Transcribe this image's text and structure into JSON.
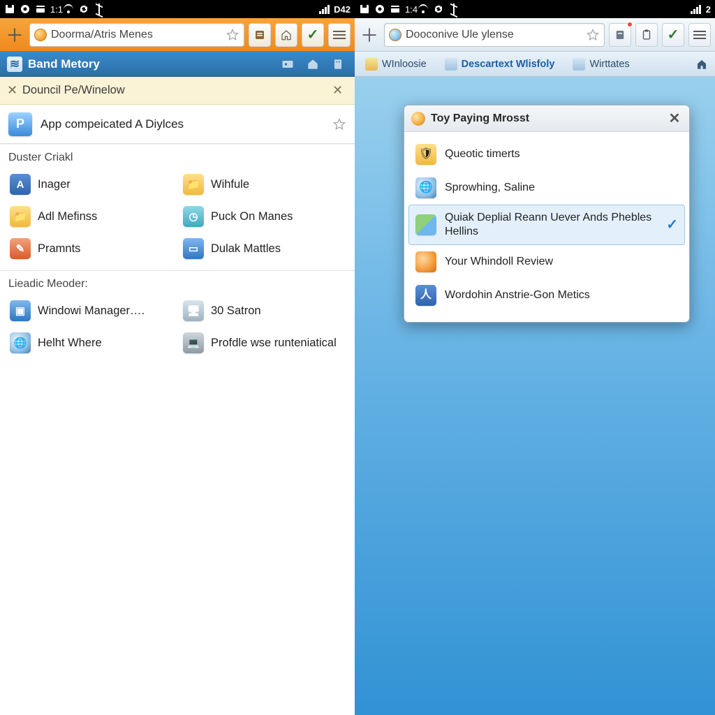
{
  "status": {
    "left": {
      "time": "1:1",
      "label": "D42"
    },
    "right": {
      "time": "1:4",
      "label": "2"
    }
  },
  "left": {
    "url": "Doorma/Atris Menes",
    "subheader": "Band Metory",
    "info_row": "Douncil Pe/Winelow",
    "featured": "App compeicated A Diylces",
    "sec1_label": "Duster Criakl",
    "sec1_items": [
      {
        "label": "Inager"
      },
      {
        "label": "Wihfule"
      },
      {
        "label": "Adl Mefinss"
      },
      {
        "label": "Puck On Manes"
      },
      {
        "label": "Pramnts"
      },
      {
        "label": "Dulak Mattles"
      }
    ],
    "sec2_label": "Lieadic Meoder:",
    "sec2_items": [
      {
        "label": "Windowi Manager…."
      },
      {
        "label": "30 Satron"
      },
      {
        "label": "Helht Where"
      },
      {
        "label": "Profdle wse runteniatical"
      }
    ]
  },
  "right": {
    "url": "Dooconive Ule ylense",
    "tabs": [
      {
        "label": "WInloosie"
      },
      {
        "label": "Descartext Wlisfoly"
      },
      {
        "label": "Wirttates"
      }
    ],
    "popup": {
      "title": "Toy Paying Mrosst",
      "items": [
        {
          "label": "Queotic timerts"
        },
        {
          "label": "Sprowhing, Saline"
        },
        {
          "label": "Quiak Deplial Reann Uever Ands Phebles Hellins",
          "selected": true
        },
        {
          "label": "Your Whindoll Review"
        },
        {
          "label": "Wordohin Anstrie-Gon Metics"
        }
      ]
    }
  }
}
